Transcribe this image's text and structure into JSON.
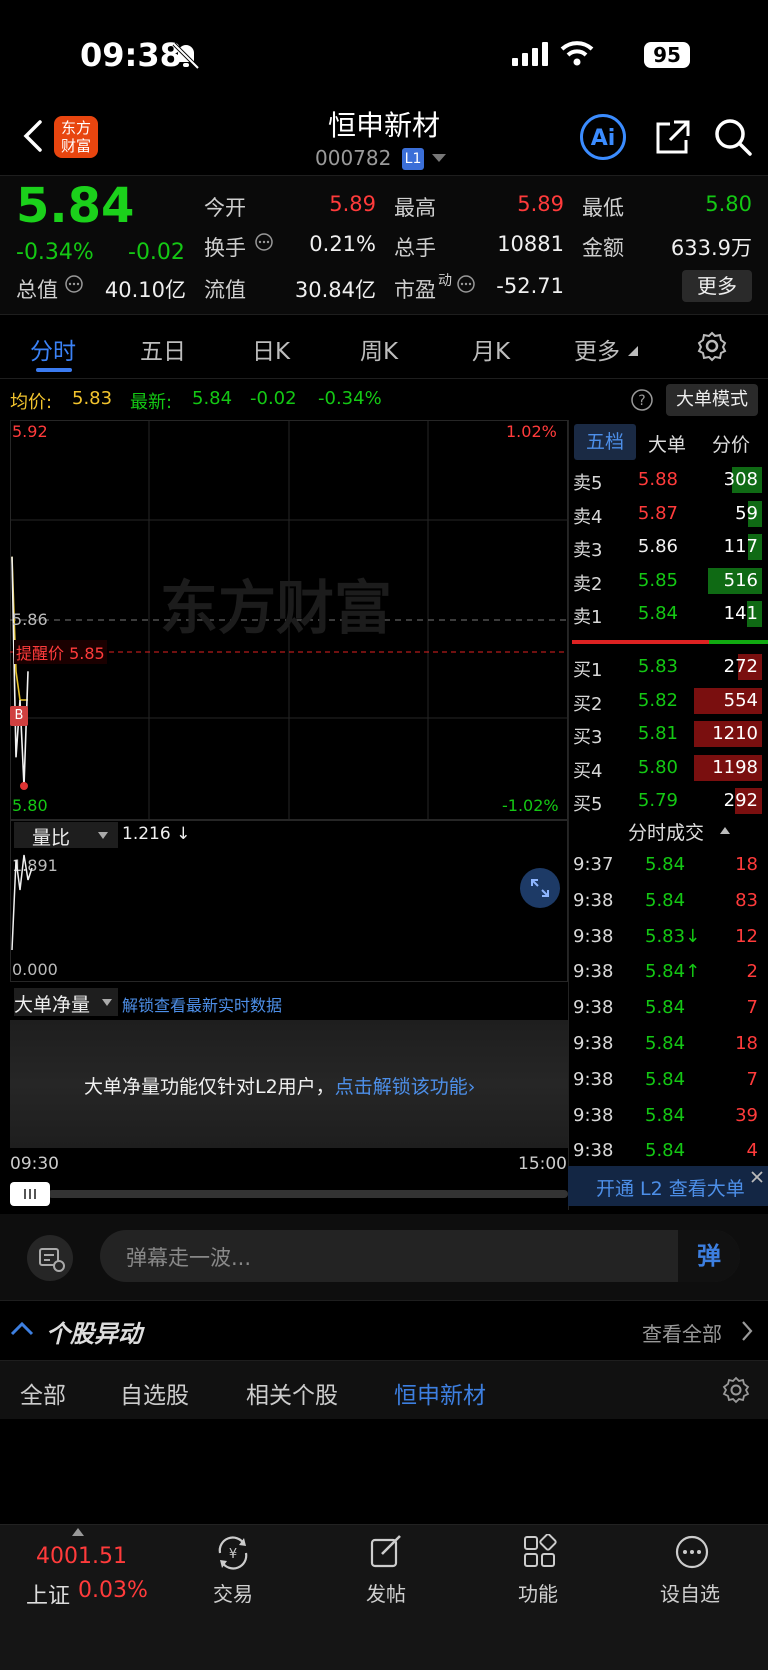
{
  "status": {
    "time": "09:38",
    "battery": "95"
  },
  "header": {
    "title": "恒申新材",
    "code": "000782",
    "badge": "L1",
    "logo_line1": "东方",
    "logo_line2": "财富",
    "ai": "Ai"
  },
  "quote": {
    "price": "5.84",
    "change_pct": "-0.34%",
    "change": "-0.02",
    "open_label": "今开",
    "open": "5.89",
    "high_label": "最高",
    "high": "5.89",
    "low_label": "最低",
    "low": "5.80",
    "turnover_label": "换手",
    "turnover": "0.21%",
    "volume_label": "总手",
    "volume": "10881",
    "amount_label": "金额",
    "amount": "633.9万",
    "mktcap_label": "总值",
    "mktcap": "40.10亿",
    "float_label": "流值",
    "float": "30.84亿",
    "pe_label": "市盈",
    "pe_sup": "动",
    "pe": "-52.71",
    "more": "更多"
  },
  "tabs": [
    "分时",
    "五日",
    "日K",
    "周K",
    "月K",
    "更多"
  ],
  "chart_header": {
    "avg_label": "均价:",
    "avg": "5.83",
    "last_label": "最新:",
    "last": "5.84",
    "chg": "-0.02",
    "chg_pct": "-0.34%",
    "mode_btn": "大单模式"
  },
  "chart": {
    "y_top": "5.92",
    "y_mid": "5.86",
    "y_bottom": "5.80",
    "pct_top": "1.02%",
    "pct_bottom": "-1.02%",
    "alert_label": "提醒价 5.85",
    "watermark": "东方财富",
    "b_marker": "B",
    "vr_label": "量比",
    "vr_value": "1.216 ↓",
    "vr_top": "1.891",
    "vr_bottom": "0.000",
    "big_label": "大单净量",
    "big_unlock": "解锁查看最新实时数据",
    "big_notice": "大单净量功能仅针对L2用户，",
    "big_notice_link": "点击解锁该功能",
    "time_start": "09:30",
    "time_end": "15:00"
  },
  "chart_data": {
    "type": "line",
    "series": [
      {
        "name": "最新",
        "points": [
          [
            0,
            5.88
          ],
          [
            1,
            5.81
          ],
          [
            2,
            5.83
          ],
          [
            3,
            5.8
          ],
          [
            4,
            5.84
          ]
        ]
      },
      {
        "name": "均价",
        "points": [
          [
            0,
            5.88
          ],
          [
            1,
            5.84
          ],
          [
            2,
            5.83
          ],
          [
            3,
            5.83
          ],
          [
            4,
            5.83
          ]
        ]
      }
    ],
    "ylim": [
      5.8,
      5.92
    ]
  },
  "orderbook": {
    "tabs": [
      "五档",
      "大单",
      "分价"
    ],
    "asks": [
      {
        "label": "卖5",
        "price": "5.88",
        "vol": "308",
        "color": "#ff3b3b",
        "frac": 0.1
      },
      {
        "label": "卖4",
        "price": "5.87",
        "vol": "59",
        "color": "#ff3b3b",
        "frac": 0.02
      },
      {
        "label": "卖3",
        "price": "5.86",
        "vol": "117",
        "color": "#f0f0f0",
        "frac": 0.04
      },
      {
        "label": "卖2",
        "price": "5.85",
        "vol": "516",
        "color": "#14c814",
        "frac": 0.18
      },
      {
        "label": "卖1",
        "price": "5.84",
        "vol": "141",
        "color": "#14c814",
        "frac": 0.05
      }
    ],
    "bids": [
      {
        "label": "买1",
        "price": "5.83",
        "vol": "272",
        "color": "#14c814",
        "frac": 0.08
      },
      {
        "label": "买2",
        "price": "5.82",
        "vol": "554",
        "color": "#14c814",
        "frac": 0.3
      },
      {
        "label": "买3",
        "price": "5.81",
        "vol": "1210",
        "color": "#14c814",
        "frac": 0.66
      },
      {
        "label": "买4",
        "price": "5.80",
        "vol": "1198",
        "color": "#14c814",
        "frac": 0.65
      },
      {
        "label": "买5",
        "price": "5.79",
        "vol": "292",
        "color": "#14c814",
        "frac": 0.09
      }
    ],
    "trades_label": "分时成交",
    "trades": [
      {
        "time": "9:37",
        "price": "5.84",
        "vol": "18"
      },
      {
        "time": "9:38",
        "price": "5.84",
        "vol": "83"
      },
      {
        "time": "9:38",
        "price": "5.83↓",
        "vol": "12"
      },
      {
        "time": "9:38",
        "price": "5.84↑",
        "vol": "2"
      },
      {
        "time": "9:38",
        "price": "5.84",
        "vol": "7"
      },
      {
        "time": "9:38",
        "price": "5.84",
        "vol": "18"
      },
      {
        "time": "9:38",
        "price": "5.84",
        "vol": "7"
      },
      {
        "time": "9:38",
        "price": "5.84",
        "vol": "39"
      },
      {
        "time": "9:38",
        "price": "5.84",
        "vol": "4"
      }
    ],
    "l2_banner": "开通 L2 查看大单"
  },
  "danmu": {
    "placeholder": "弹幕走一波...",
    "send": "弹"
  },
  "movement": {
    "title": "个股异动",
    "view_all": "查看全部",
    "tabs": [
      "全部",
      "自选股",
      "相关个股",
      "恒申新材"
    ]
  },
  "bottom_nav": {
    "index_value": "4001.51",
    "index_name": "上证",
    "index_pct": "0.03%",
    "items": [
      "交易",
      "发帖",
      "功能",
      "设自选"
    ]
  }
}
